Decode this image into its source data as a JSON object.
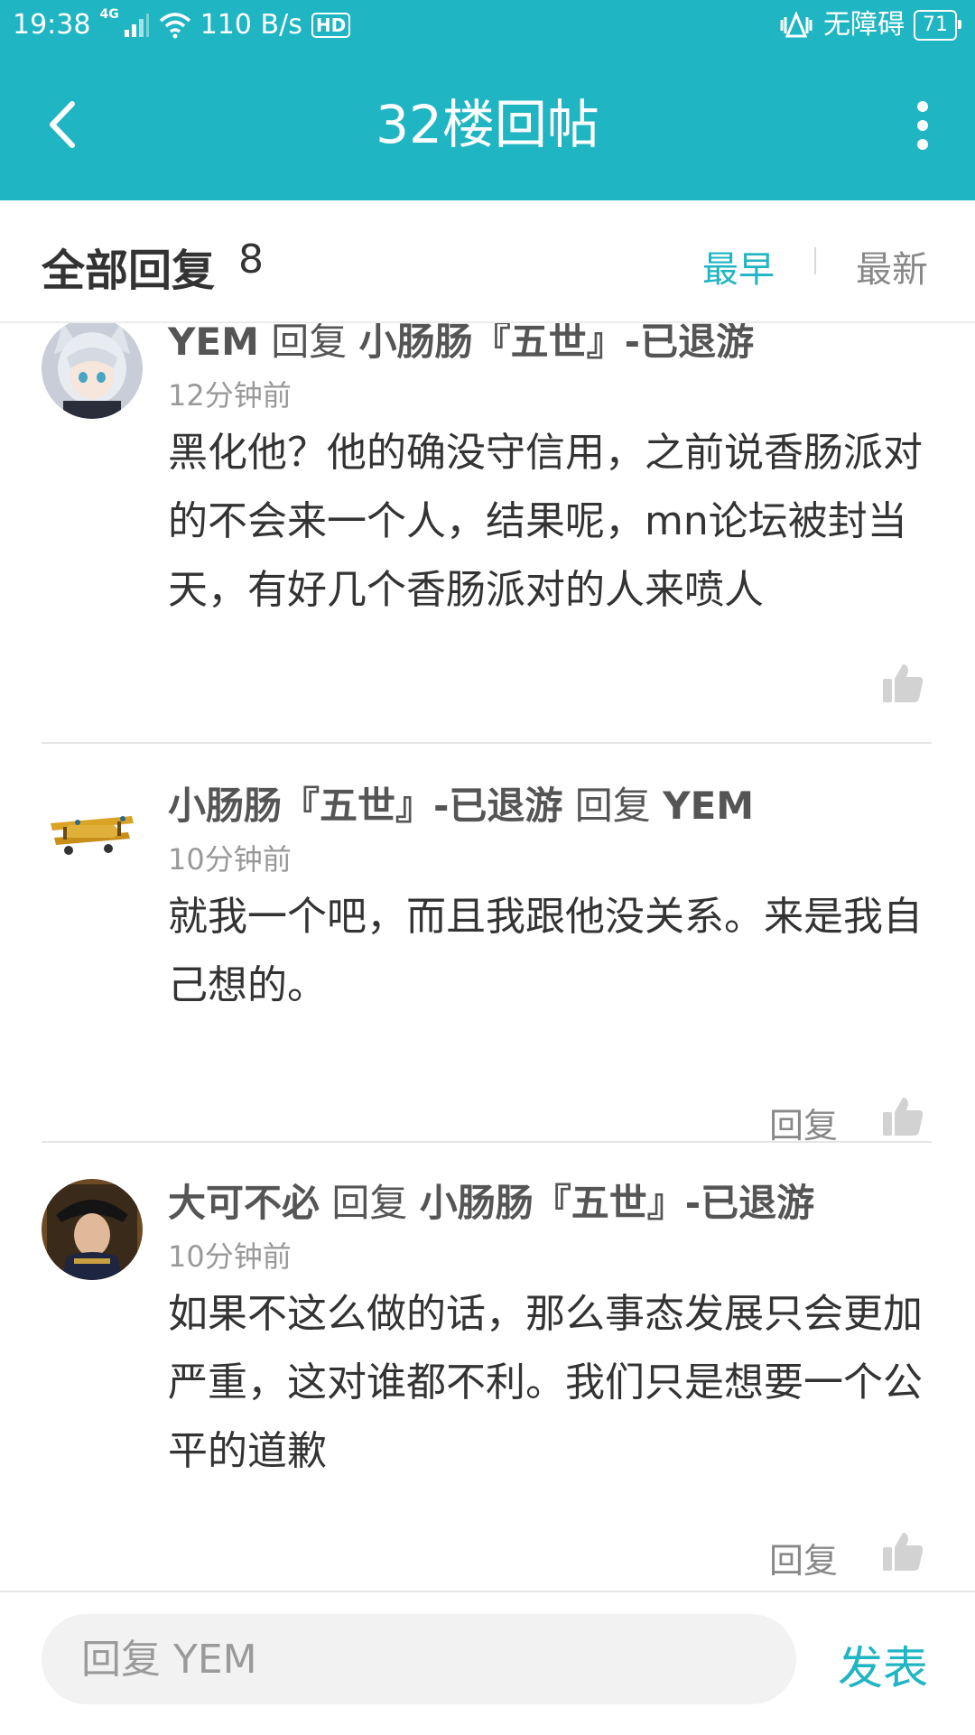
{
  "status_bar": {
    "time": "19:38",
    "network_type": "4G",
    "net_speed": "110 B/s",
    "hd_label": "HD",
    "accessibility_label": "无障碍",
    "battery": "71"
  },
  "header": {
    "title": "32楼回帖"
  },
  "filter_bar": {
    "all_replies_label": "全部回复",
    "reply_count": "8",
    "sort_earliest": "最早",
    "sort_newest": "最新"
  },
  "comments": [
    {
      "author": "YEM",
      "reply_word": "回复",
      "target": "小肠肠『五世』-已退游",
      "time": "12分钟前",
      "body": "黑化他？他的确没守信用，之前说香肠派对的不会来一个人，结果呢，mn论坛被封当天，有好几个香肠派对的人来喷人",
      "reply_label": ""
    },
    {
      "author": "小肠肠『五世』-已退游",
      "reply_word": "回复",
      "target": "YEM",
      "time": "10分钟前",
      "body": "就我一个吧，而且我跟他没关系。来是我自己想的。",
      "reply_label": "回复"
    },
    {
      "author": "大可不必",
      "reply_word": "回复",
      "target": "小肠肠『五世』-已退游",
      "time": "10分钟前",
      "body": "如果不这么做的话，那么事态发展只会更加严重，这对谁都不利。我们只是想要一个公平的道歉",
      "reply_label": "回复"
    }
  ],
  "bottom_bar": {
    "input_placeholder": "回复 YEM",
    "submit_label": "发表"
  },
  "colors": {
    "accent": "#1fb5c2",
    "text_primary": "#333333",
    "text_secondary": "#999999"
  },
  "icons": {
    "back": "chevron-left-icon",
    "more": "more-vertical-icon",
    "like": "thumbs-up-icon",
    "wifi": "wifi-icon",
    "signal": "signal-icon"
  }
}
